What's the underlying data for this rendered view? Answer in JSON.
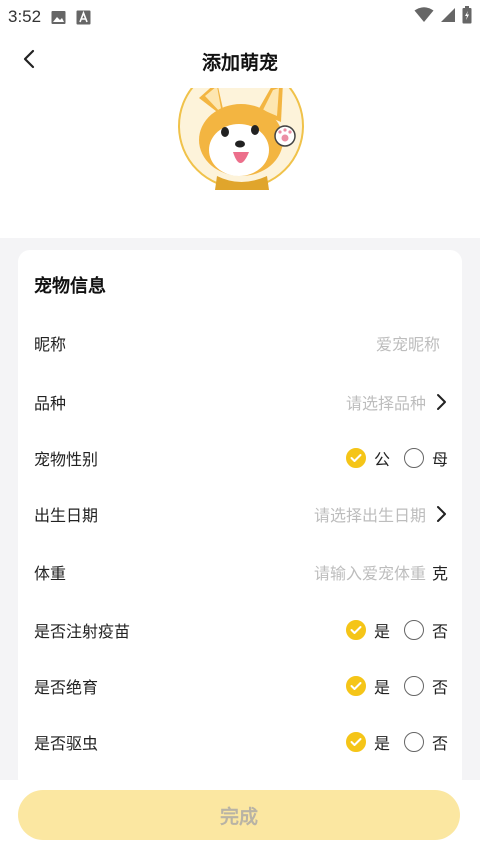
{
  "status_bar": {
    "time": "3:52",
    "icons_left": [
      "image-icon",
      "a-box-icon"
    ],
    "icons_right": [
      "wifi-icon",
      "signal-icon",
      "battery-icon"
    ]
  },
  "header": {
    "title": "添加萌宠",
    "back_icon": "chevron-left-icon"
  },
  "avatar": {
    "icon": "corgi-avatar-image"
  },
  "card": {
    "title": "宠物信息",
    "rows": [
      {
        "label": "昵称",
        "placeholder": "爱宠昵称"
      },
      {
        "label": "品种",
        "placeholder": "请选择品种"
      },
      {
        "label": "宠物性别",
        "options": [
          "公",
          "母"
        ],
        "selected": "公"
      },
      {
        "label": "出生日期",
        "placeholder": "请选择出生日期"
      },
      {
        "label": "体重",
        "placeholder": "请输入爱宠体重",
        "unit": "克"
      },
      {
        "label": "是否注射疫苗",
        "options": [
          "是",
          "否"
        ],
        "selected": "是"
      },
      {
        "label": "是否绝育",
        "options": [
          "是",
          "否"
        ],
        "selected": "是"
      },
      {
        "label": "是否驱虫",
        "options": [
          "是",
          "否"
        ],
        "selected": "是"
      }
    ]
  },
  "done_button": {
    "label": "完成"
  },
  "colors": {
    "accent": "#f5c518",
    "button_bg": "#fbe7a1",
    "button_text": "#b8b3a5",
    "page_bg": "#f4f4f6"
  }
}
